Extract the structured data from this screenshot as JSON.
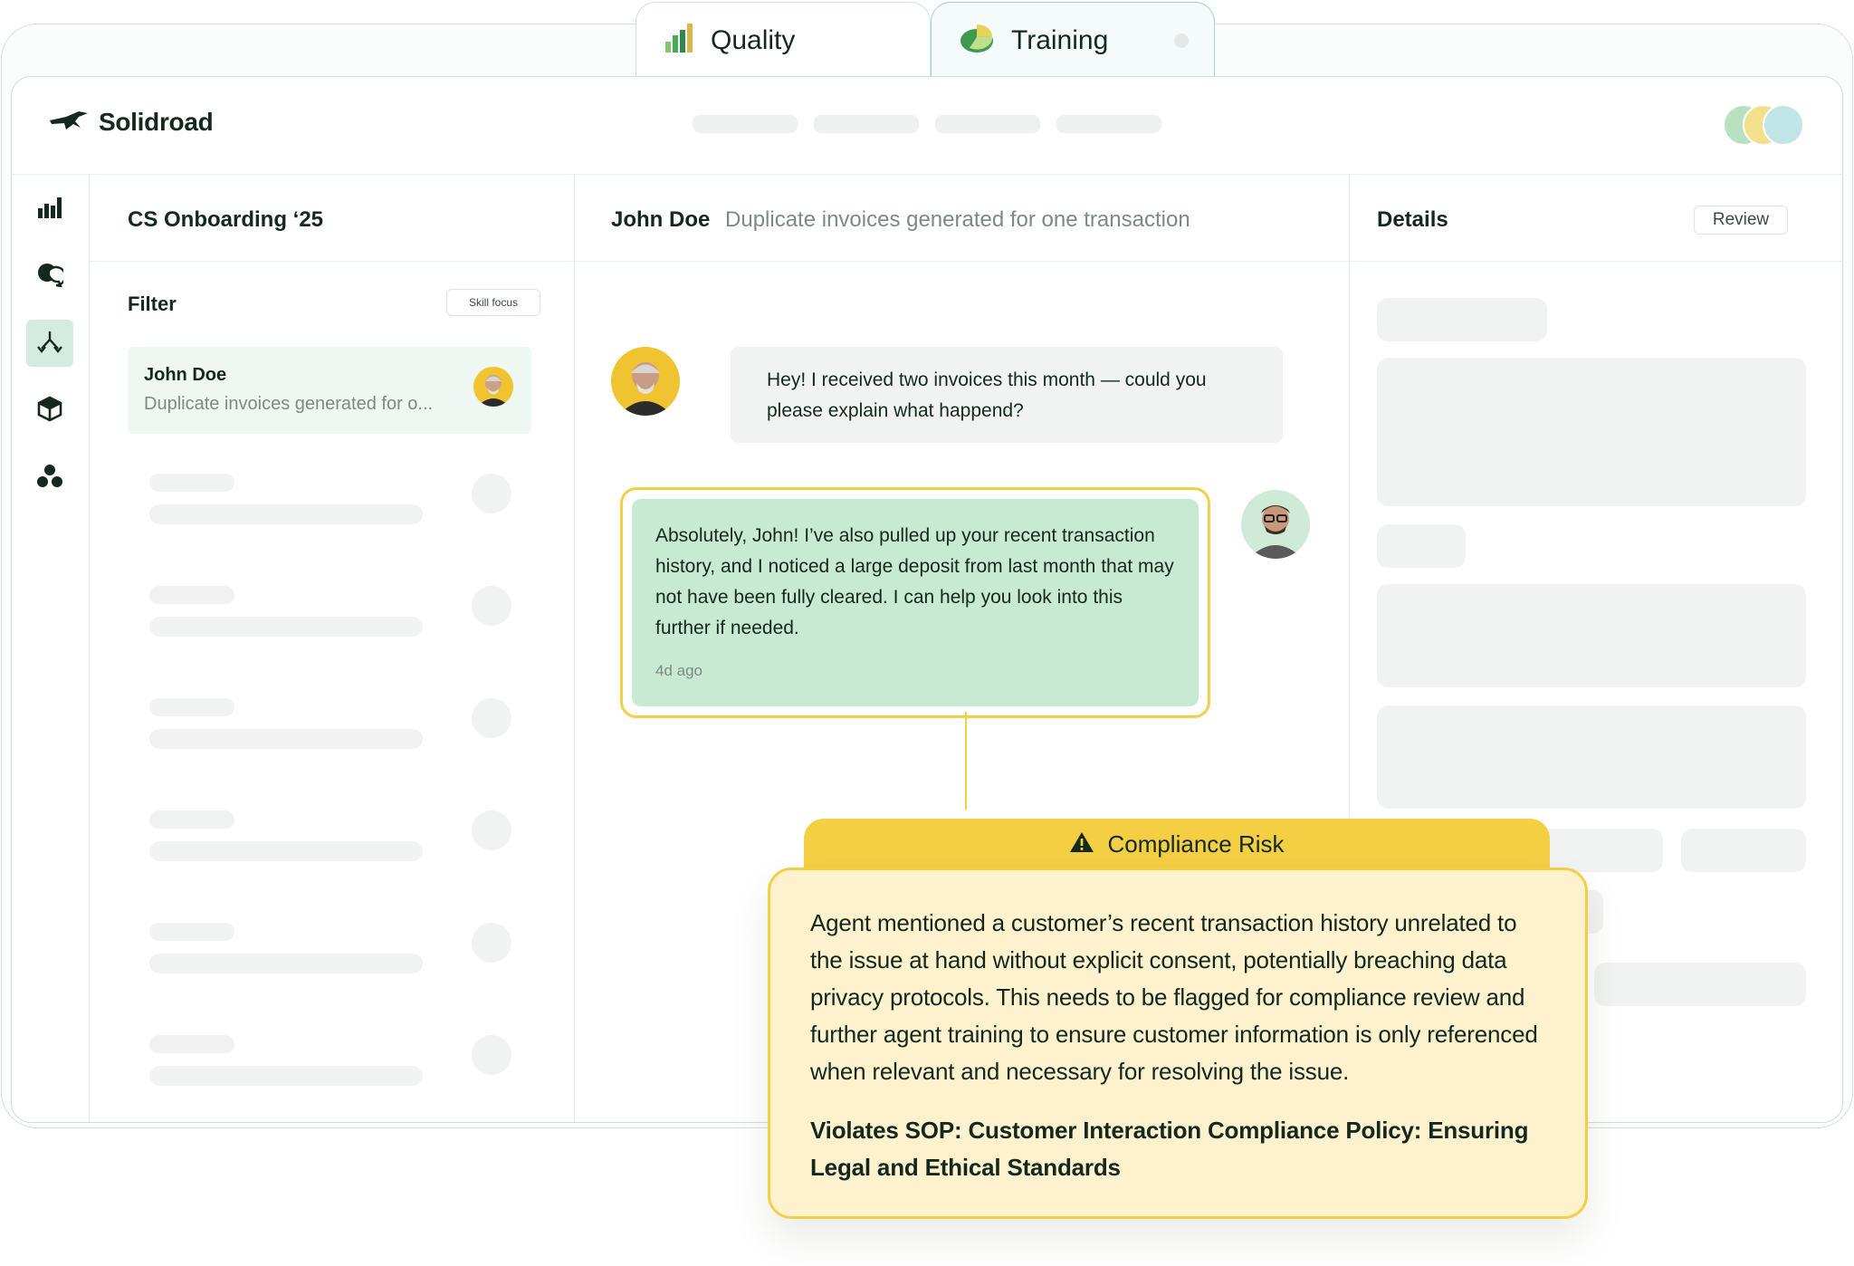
{
  "tabs": [
    {
      "label": "Quality",
      "icon": "bar-chart-icon"
    },
    {
      "label": "Training",
      "icon": "pie-chart-icon"
    }
  ],
  "app": {
    "brand": "Solidroad"
  },
  "sidebar": {
    "icons": [
      "bar-chart-icon",
      "chat-bubbles-icon",
      "branch-icon",
      "cube-icon",
      "cluster-icon"
    ],
    "active_index": 2
  },
  "list_panel": {
    "title": "CS Onboarding ‘25",
    "filter_label": "Filter",
    "filter_chip": "Skill focus",
    "items": [
      {
        "name": "John Doe",
        "preview": "Duplicate invoices generated for o..."
      }
    ]
  },
  "chat_panel": {
    "customer_name": "John Doe",
    "subject": "Duplicate invoices generated for one transaction",
    "messages": [
      {
        "role": "customer",
        "text": "Hey! I received two invoices this month — could you please explain what happend?"
      },
      {
        "role": "agent",
        "text": "Absolutely, John! I’ve also pulled up your recent transaction history, and I noticed a large deposit from last month that may not have been fully cleared. I can help you look into this further if needed.",
        "time": "4d ago"
      }
    ]
  },
  "details_panel": {
    "title": "Details",
    "review_label": "Review"
  },
  "compliance": {
    "title": "Compliance Risk",
    "body": "Agent mentioned a customer’s recent transaction history unrelated to the issue at hand without explicit consent, potentially breaching data privacy protocols. This needs to be flagged for compliance review and further agent training to ensure customer information is only referenced when relevant and necessary for resolving the issue.",
    "sop": "Violates SOP: Customer Interaction Compliance Policy: Ensuring Legal and Ethical Standards"
  },
  "colors": {
    "accent_green": "#c8ead2",
    "highlight_yellow": "#f3cf45",
    "card_cream": "#fdf1ce",
    "ink": "#14281d"
  }
}
